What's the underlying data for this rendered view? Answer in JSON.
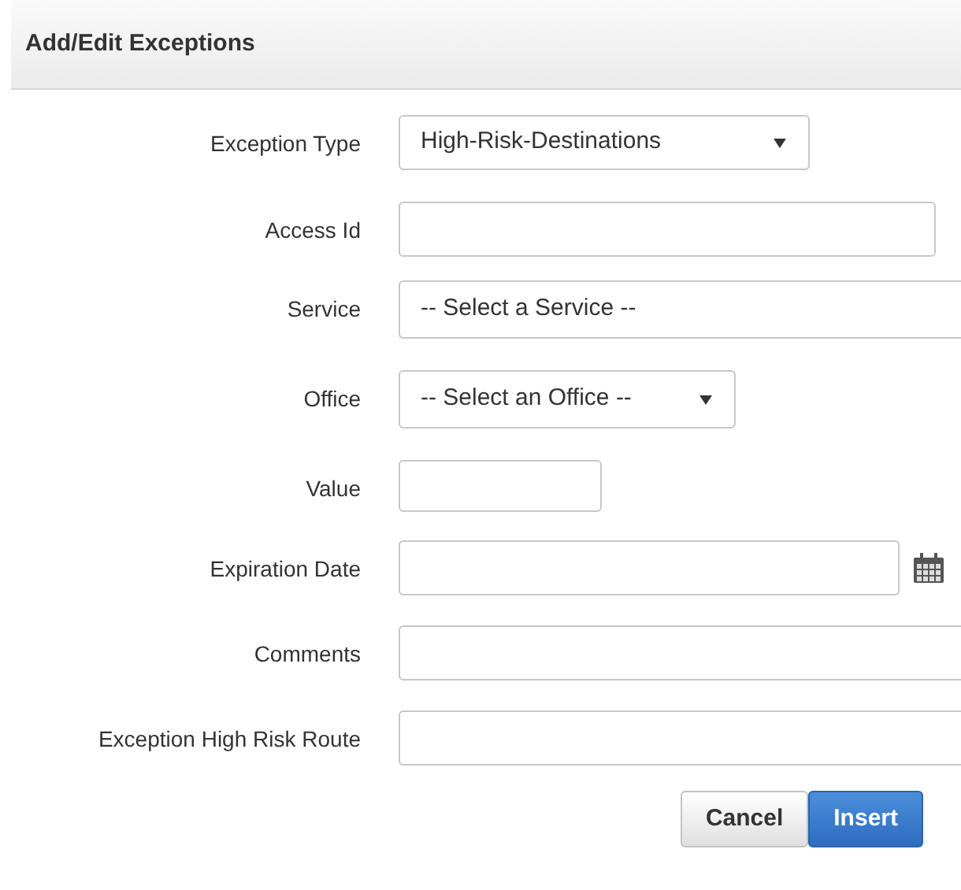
{
  "panel": {
    "title": "Add/Edit Exceptions"
  },
  "fields": [
    {
      "label": "Exception Type",
      "kind": "select",
      "value": "High-Risk-Destinations"
    },
    {
      "label": "Access Id",
      "kind": "text"
    },
    {
      "label": "Service",
      "kind": "select",
      "value": "-- Select a Service --"
    },
    {
      "label": "Office",
      "kind": "select",
      "value": "-- Select an Office --"
    },
    {
      "label": "Value",
      "kind": "text"
    },
    {
      "label": "Expiration Date",
      "kind": "date"
    },
    {
      "label": "Comments",
      "kind": "text"
    },
    {
      "label": "Exception High Risk Route",
      "kind": "text"
    }
  ],
  "buttons": [
    {
      "label": "Cancel",
      "kind": "secondary"
    },
    {
      "label": "Insert",
      "kind": "primary"
    }
  ]
}
